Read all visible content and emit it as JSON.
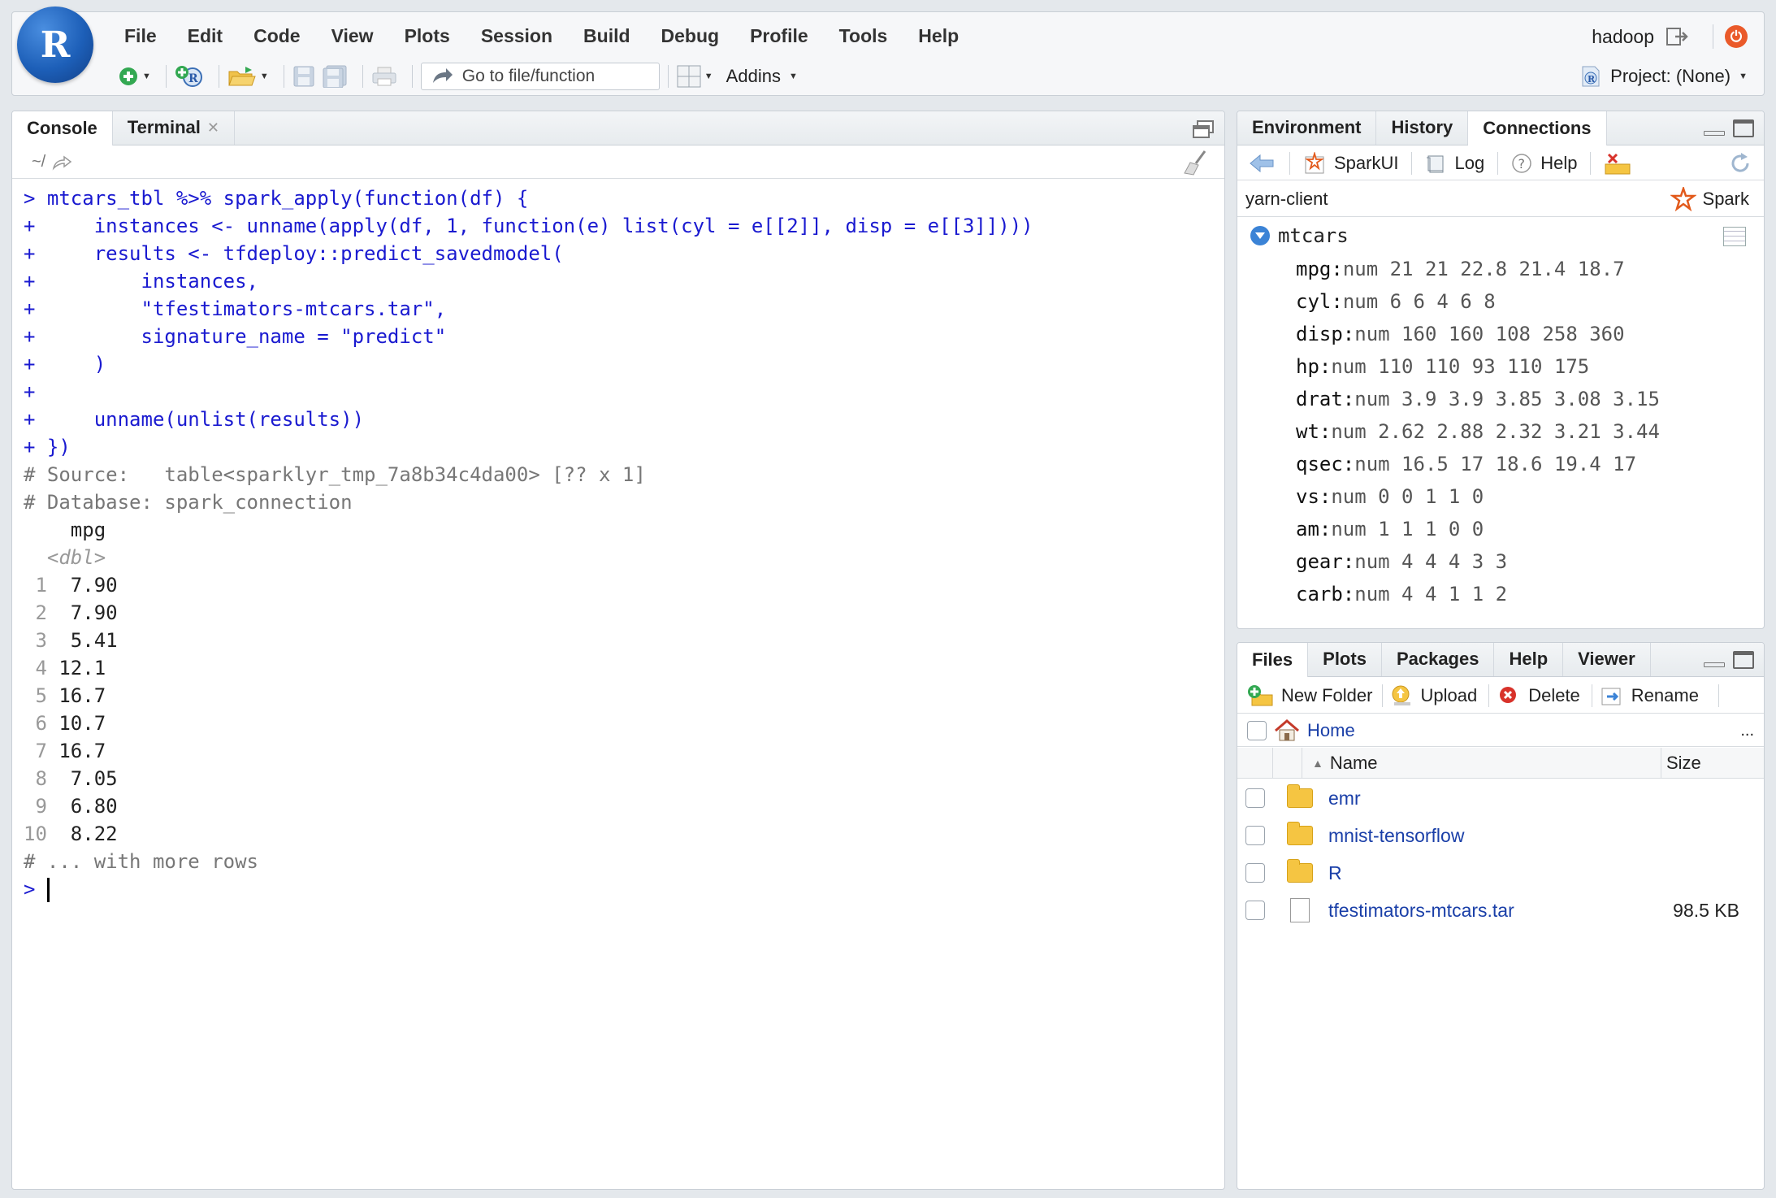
{
  "app": {
    "logo_letter": "R",
    "menu": [
      "File",
      "Edit",
      "Code",
      "View",
      "Plots",
      "Session",
      "Build",
      "Debug",
      "Profile",
      "Tools",
      "Help"
    ],
    "user": "hadoop",
    "toolbar": {
      "goto_placeholder": "Go to file/function",
      "addins_label": "Addins",
      "project_label": "Project: (None)"
    }
  },
  "console": {
    "tabs": [
      {
        "label": "Console",
        "active": true
      },
      {
        "label": "Terminal",
        "active": false,
        "closable": true
      }
    ],
    "working_dir": "~/",
    "lines": [
      {
        "type": "cmd",
        "text": "> mtcars_tbl %>% spark_apply(function(df) {"
      },
      {
        "type": "cmd",
        "text": "+     instances <- unname(apply(df, 1, function(e) list(cyl = e[[2]], disp = e[[3]])))"
      },
      {
        "type": "cmd",
        "text": "+     results <- tfdeploy::predict_savedmodel("
      },
      {
        "type": "cmd",
        "text": "+         instances,"
      },
      {
        "type": "cmd",
        "text": "+         \"tfestimators-mtcars.tar\","
      },
      {
        "type": "cmd",
        "text": "+         signature_name = \"predict\""
      },
      {
        "type": "cmd",
        "text": "+     )"
      },
      {
        "type": "cmd",
        "text": "+"
      },
      {
        "type": "cmd",
        "text": "+     unname(unlist(results))"
      },
      {
        "type": "cmd",
        "text": "+ })"
      },
      {
        "type": "cmt",
        "text": "# Source:   table<sparklyr_tmp_7a8b34c4da00> [?? x 1]"
      },
      {
        "type": "cmt",
        "text": "# Database: spark_connection"
      },
      {
        "type": "out",
        "text": "    mpg"
      },
      {
        "type": "type",
        "text": "  <dbl>"
      },
      {
        "type": "row",
        "idx": " 1",
        "val": "  7.90"
      },
      {
        "type": "row",
        "idx": " 2",
        "val": "  7.90"
      },
      {
        "type": "row",
        "idx": " 3",
        "val": "  5.41"
      },
      {
        "type": "row",
        "idx": " 4",
        "val": " 12.1"
      },
      {
        "type": "row",
        "idx": " 5",
        "val": " 16.7"
      },
      {
        "type": "row",
        "idx": " 6",
        "val": " 10.7"
      },
      {
        "type": "row",
        "idx": " 7",
        "val": " 16.7"
      },
      {
        "type": "row",
        "idx": " 8",
        "val": "  7.05"
      },
      {
        "type": "row",
        "idx": " 9",
        "val": "  6.80"
      },
      {
        "type": "row",
        "idx": "10",
        "val": "  8.22"
      },
      {
        "type": "cmt",
        "text": "# ... with more rows"
      },
      {
        "type": "prompt",
        "text": "> "
      }
    ]
  },
  "connections": {
    "tabs": [
      {
        "label": "Environment",
        "active": false
      },
      {
        "label": "History",
        "active": false
      },
      {
        "label": "Connections",
        "active": true
      }
    ],
    "toolbar": [
      "SparkUI",
      "Log",
      "Help"
    ],
    "master": "yarn-client",
    "connection_type": "Spark",
    "table": "mtcars",
    "fields": [
      {
        "name": "mpg",
        "type": "num 21 21 22.8 21.4 18.7"
      },
      {
        "name": "cyl",
        "type": "num 6 6 4 6 8"
      },
      {
        "name": "disp",
        "type": "num 160 160 108 258 360"
      },
      {
        "name": "hp",
        "type": "num 110 110 93 110 175"
      },
      {
        "name": "drat",
        "type": "num 3.9 3.9 3.85 3.08 3.15"
      },
      {
        "name": "wt",
        "type": "num 2.62 2.88 2.32 3.21 3.44"
      },
      {
        "name": "qsec",
        "type": "num 16.5 17 18.6 19.4 17"
      },
      {
        "name": "vs",
        "type": "num 0 0 1 1 0"
      },
      {
        "name": "am",
        "type": "num 1 1 1 0 0"
      },
      {
        "name": "gear",
        "type": "num 4 4 4 3 3"
      },
      {
        "name": "carb",
        "type": "num 4 4 1 1 2"
      }
    ]
  },
  "files": {
    "tabs": [
      {
        "label": "Files",
        "active": true
      },
      {
        "label": "Plots",
        "active": false
      },
      {
        "label": "Packages",
        "active": false
      },
      {
        "label": "Help",
        "active": false
      },
      {
        "label": "Viewer",
        "active": false
      }
    ],
    "toolbar": [
      "New Folder",
      "Upload",
      "Delete",
      "Rename"
    ],
    "path": "Home",
    "more": "...",
    "columns": {
      "name": "Name",
      "size": "Size"
    },
    "entries": [
      {
        "name": "emr",
        "kind": "folder",
        "size": ""
      },
      {
        "name": "mnist-tensorflow",
        "kind": "folder",
        "size": ""
      },
      {
        "name": "R",
        "kind": "folder",
        "size": ""
      },
      {
        "name": "tfestimators-mtcars.tar",
        "kind": "file",
        "size": "98.5 KB"
      }
    ]
  },
  "colors": {
    "console_command": "#1a1ad0",
    "console_comment": "#777777",
    "link": "#1a3fa8",
    "accent_blue": "#3b83d6"
  }
}
